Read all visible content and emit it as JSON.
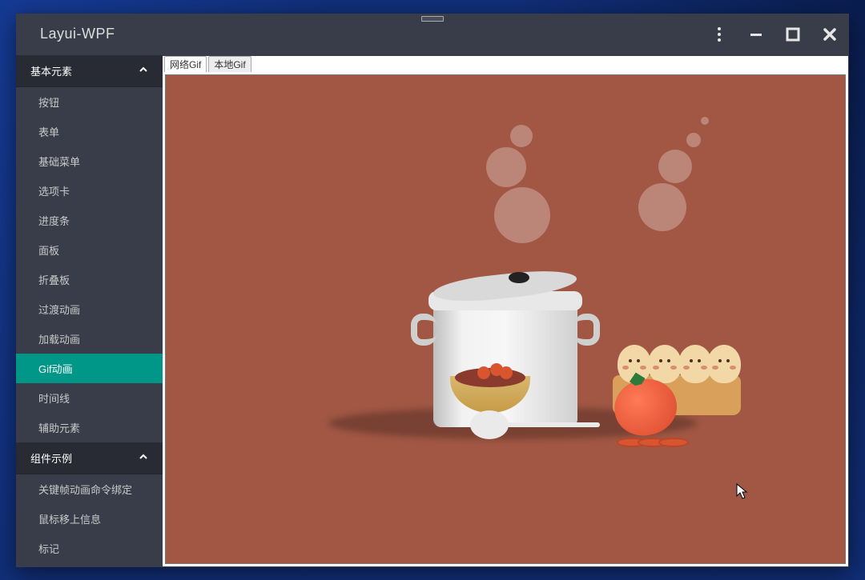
{
  "window": {
    "title": "Layui-WPF"
  },
  "titlebar_icons": {
    "more": "more-vertical-icon",
    "minimize": "minimize-icon",
    "maximize": "maximize-icon",
    "close": "close-icon"
  },
  "sidebar": {
    "groups": [
      {
        "label": "基本元素",
        "expanded": true,
        "items": [
          {
            "label": "按钮",
            "active": false
          },
          {
            "label": "表单",
            "active": false
          },
          {
            "label": "基础菜单",
            "active": false
          },
          {
            "label": "选项卡",
            "active": false
          },
          {
            "label": "进度条",
            "active": false
          },
          {
            "label": "面板",
            "active": false
          },
          {
            "label": "折叠板",
            "active": false
          },
          {
            "label": "过渡动画",
            "active": false
          },
          {
            "label": "加载动画",
            "active": false
          },
          {
            "label": "Gif动画",
            "active": true
          },
          {
            "label": "时间线",
            "active": false
          },
          {
            "label": "辅助元素",
            "active": false
          }
        ]
      },
      {
        "label": "组件示例",
        "expanded": true,
        "items": [
          {
            "label": "关键帧动画命令绑定",
            "active": false
          },
          {
            "label": "鼠标移上信息",
            "active": false
          },
          {
            "label": "标记",
            "active": false
          }
        ]
      }
    ]
  },
  "content": {
    "tabs": [
      {
        "label": "网络Gif",
        "active": true
      },
      {
        "label": "本地Gif",
        "active": false
      }
    ],
    "canvas": {
      "description": "cooking-pot-illustration",
      "background_color": "#A15744"
    }
  },
  "colors": {
    "window_bg": "#393D49",
    "sidebar_header_bg": "#282B33",
    "active_item_bg": "#009688",
    "content_bg": "#FFFFFF"
  }
}
